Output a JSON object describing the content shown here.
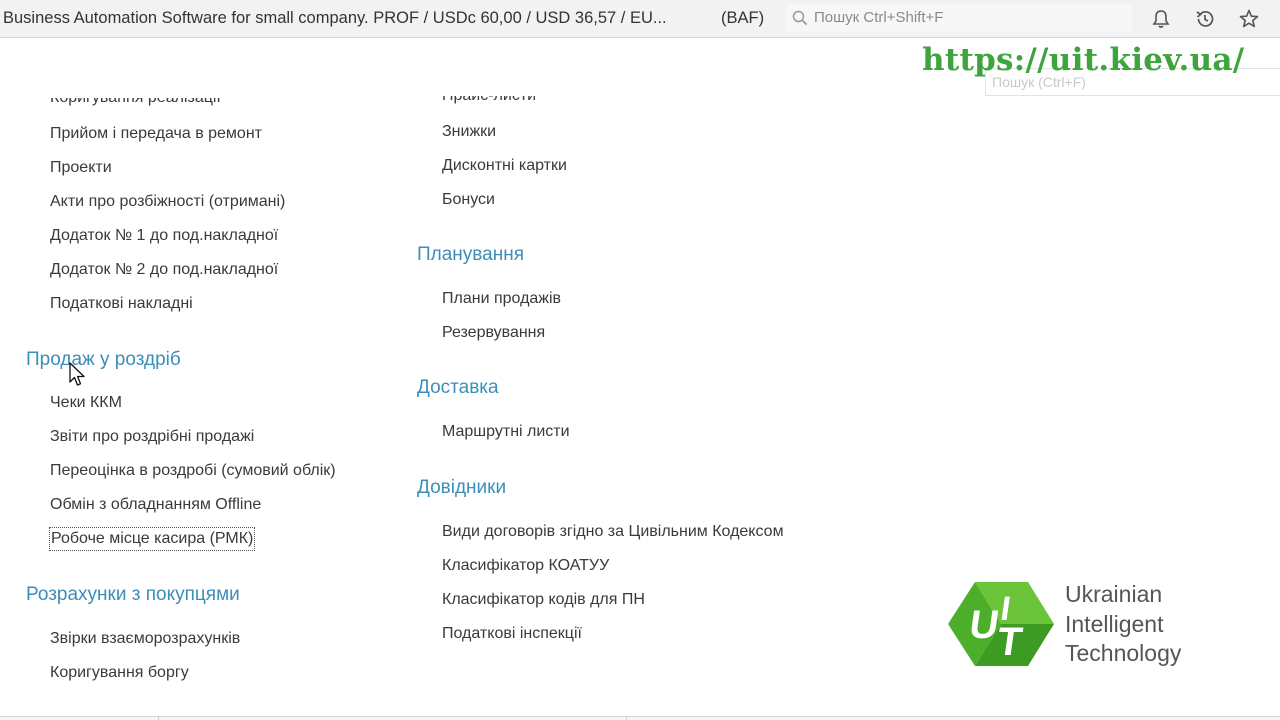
{
  "window": {
    "title": "Business Automation Software for small company. PROF / USDc 60,00 / USD 36,57 / EU...",
    "tag": "(BAF)"
  },
  "search": {
    "placeholder": "Пошук Ctrl+Shift+F"
  },
  "toolbar_icons": [
    "bell-icon",
    "history-icon",
    "star-icon"
  ],
  "watermark": {
    "url": "https://uit.kiev.ua/"
  },
  "ghost_search": {
    "placeholder": "Пошук (Ctrl+F)"
  },
  "left_column": {
    "cut_item": "Коригування реалізації",
    "items_top": [
      "Прийом і передача в ремонт",
      "Проекти",
      "Акти про розбіжності (отримані)",
      "Додаток № 1 до под.накладної",
      "Додаток № 2 до под.накладної",
      "Податкові накладні"
    ],
    "retail": {
      "title": "Продаж у роздріб",
      "items": [
        "Чеки ККМ",
        "Звіти про роздрібні продажі",
        "Переоцінка в роздробі (сумовий облік)",
        "Обмін з обладнанням Offline",
        "Робоче місце касира (РМК)"
      ]
    },
    "settlements": {
      "title": "Розрахунки з покупцями",
      "items": [
        "Звірки взаєморозрахунків",
        "Коригування боргу"
      ]
    }
  },
  "right_column": {
    "cut_item": "Прайс-листи",
    "items_top": [
      "Знижки",
      "Дисконтні картки",
      "Бонуси"
    ],
    "planning": {
      "title": "Планування",
      "items": [
        "Плани продажів",
        "Резервування"
      ]
    },
    "delivery": {
      "title": "Доставка",
      "items": [
        "Маршрутні листи"
      ]
    },
    "references": {
      "title": "Довідники",
      "items": [
        "Види договорів згідно за Цивільним Кодексом",
        "Класифікатор КОАТУУ",
        "Класифікатор кодів для ПН",
        "Податкові інспекції"
      ]
    }
  },
  "logo": {
    "letters": [
      "U",
      "I",
      "T"
    ],
    "lines": [
      "Ukrainian",
      "Intelligent",
      "Technology"
    ]
  },
  "colors": {
    "section": "#3b8eb9",
    "text": "#3a3a3a",
    "watermark": "#3ea53e",
    "logo_green": "#4caf2a"
  }
}
